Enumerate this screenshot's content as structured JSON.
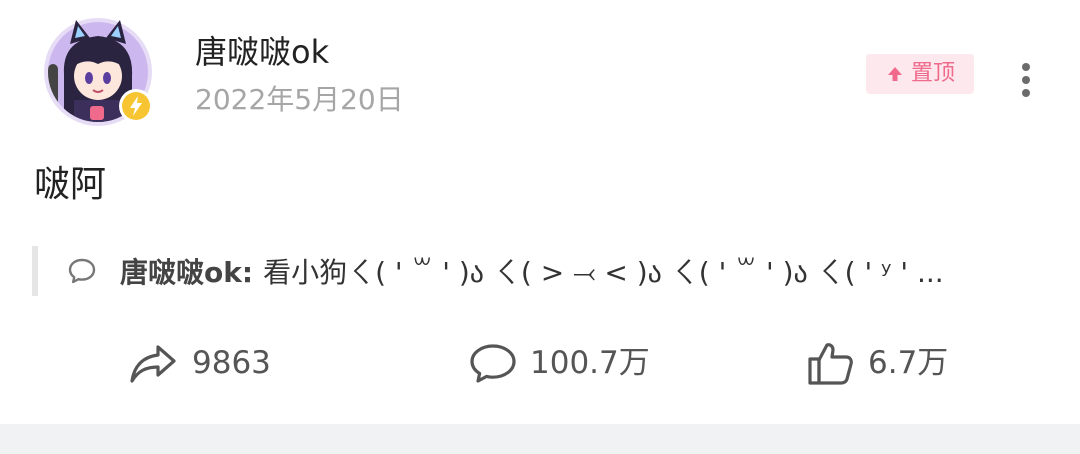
{
  "post": {
    "author_name": "唐啵啵ok",
    "date": "2022年5月20日",
    "pin_label": "置顶",
    "text": "啵阿"
  },
  "comment_preview": {
    "author": "唐啵啵ok:",
    "text": "看小狗ㄑ( ' ꒳ ' )ა ㄑ( > ⤙ < )ა ㄑ( ' ꒳ ' )ა ㄑ( ' ʸ ' ..."
  },
  "actions": {
    "share_count": "9863",
    "comment_count": "100.7万",
    "like_count": "6.7万"
  },
  "icons": {
    "avatar": "avatar-image",
    "verified": "lightning-badge-icon",
    "pin": "arrow-up-icon",
    "more": "more-vertical-icon",
    "comment_preview": "chat-bubble-icon",
    "share": "share-arrow-icon",
    "comment": "comment-icon",
    "like": "thumbs-up-icon"
  },
  "colors": {
    "pin_background": "#fde8ee",
    "pin_text": "#f06a8c",
    "verified_badge": "#f7c531",
    "muted_text": "#a6a6a6"
  }
}
